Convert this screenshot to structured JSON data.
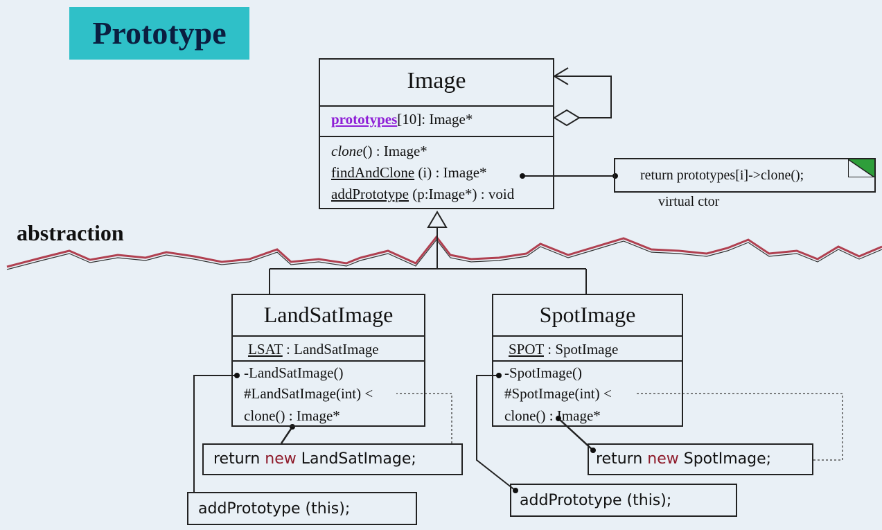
{
  "title": "Prototype",
  "abstraction_label": "abstraction",
  "image_class": {
    "name": "Image",
    "attr_name": "prototypes",
    "attr_rest": "[10]: Image*",
    "op_clone_name": "clone",
    "op_clone_rest": "() : Image*",
    "op_find_name": "findAndClone",
    "op_find_rest": " (i) : Image*",
    "op_add_name": "addPrototype",
    "op_add_rest": " (p:Image*) : void"
  },
  "note": {
    "code": "return prototypes[i]->clone();",
    "caption": "virtual ctor"
  },
  "landsat_class": {
    "name": "LandSatImage",
    "attr_name": "LSAT",
    "attr_rest": " : LandSatImage",
    "ops": [
      "-LandSatImage()",
      "#LandSatImage(int) <",
      "clone() : Image*"
    ]
  },
  "spot_class": {
    "name": "SpotImage",
    "attr_name": "SPOT",
    "attr_rest": " : SpotImage",
    "ops": [
      "-SpotImage()",
      "#SpotImage(int) <",
      "clone() : Image*"
    ]
  },
  "code": {
    "landsat_return_kw1": "return ",
    "landsat_return_kw2": "new",
    "landsat_return_rest": " LandSatImage;",
    "landsat_add": "addPrototype (this);",
    "spot_return_kw1": "return ",
    "spot_return_kw2": "new",
    "spot_return_rest": " SpotImage;",
    "spot_add": "addPrototype (this);"
  },
  "colors": {
    "title_bg": "#2fc0c8",
    "highlight": "#8e1ed6",
    "keyword": "#8e1a2a",
    "divider_wave": "#b04050",
    "note_corner": "#2e9e3a"
  }
}
